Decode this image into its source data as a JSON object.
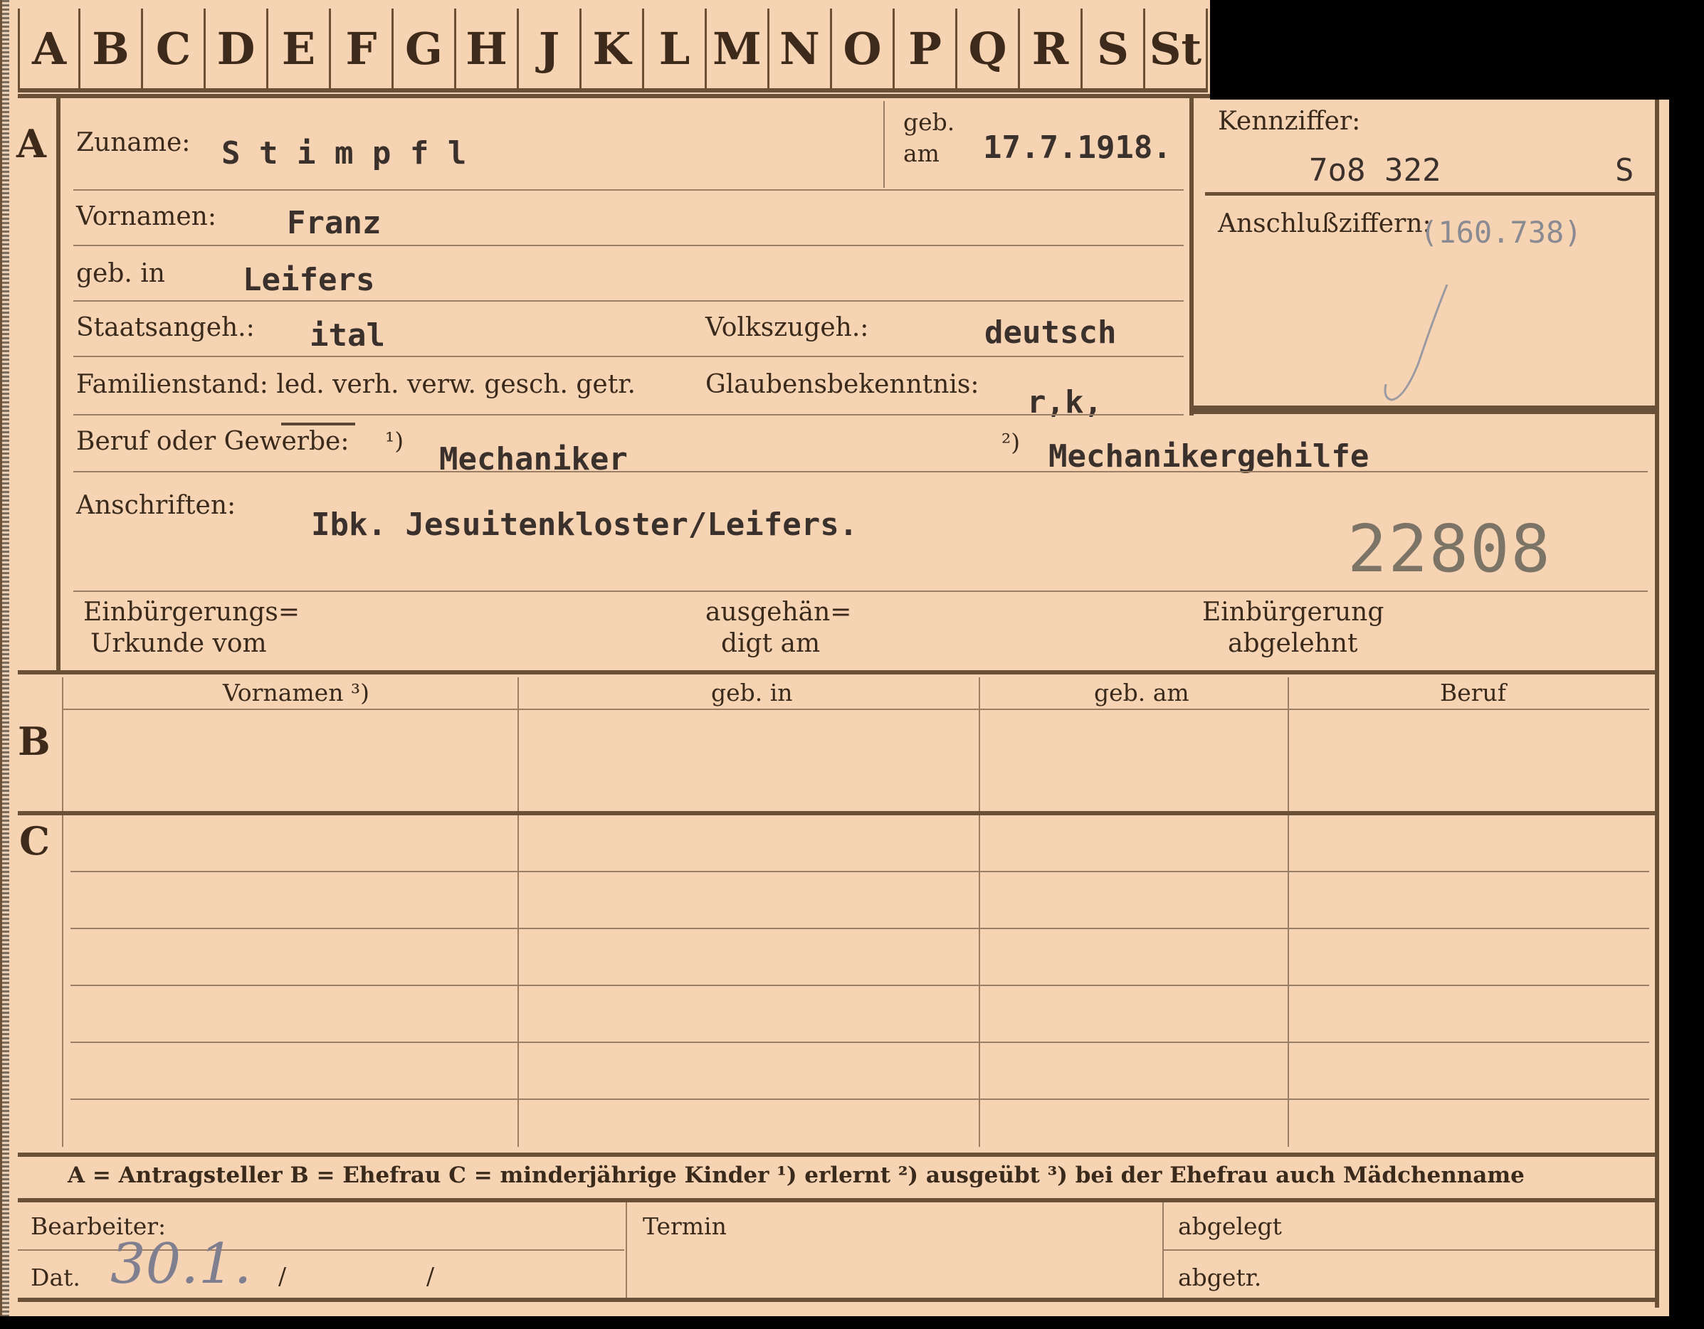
{
  "tabs": [
    "A",
    "B",
    "C",
    "D",
    "E",
    "F",
    "G",
    "H",
    "J",
    "K",
    "L",
    "M",
    "N",
    "O",
    "P",
    "Q",
    "R",
    "S",
    "St"
  ],
  "section_letters": {
    "a": "A",
    "b": "B",
    "c": "C"
  },
  "section_a": {
    "surname_label": "Zuname:",
    "surname_value": "S t i m p f l",
    "born_label_1": "geb.",
    "born_label_2": "am",
    "born_value": "17.7.1918.",
    "given_label": "Vornamen:",
    "given_value": "Franz",
    "birthplace_label": "geb. in",
    "birthplace_value": "Leifers",
    "citizenship_label": "Staatsangeh.:",
    "citizenship_value": "ital",
    "ethnicity_label": "Volkszugeh.:",
    "ethnicity_value": "deutsch",
    "marital_label": "Familienstand: led. verh. verw. gesch. getr.",
    "religion_label": "Glaubensbekenntnis:",
    "religion_value": "r,k,",
    "profession_label": "Beruf oder Gewerbe:",
    "profession_note1": "¹)",
    "profession_value1": "Mechaniker",
    "profession_note2": "²)",
    "profession_value2": "Mechanikergehilfe",
    "address_label": "Anschriften:",
    "address_value": "Ibk. Jesuitenkloster/Leifers.",
    "stamp_number": "22808",
    "naturalization_doc_1": "Einbürgerungs=",
    "naturalization_doc_2": "Urkunde vom",
    "handed_1": "ausgehän=",
    "handed_2": "digt am",
    "refused_1": "Einbürgerung",
    "refused_2": "abgelehnt"
  },
  "id_box": {
    "id_label": "Kennziffer:",
    "id_value": "7o8 322",
    "id_suffix": "S",
    "ref_label": "Anschlußziffern:",
    "ref_value": "(160.738)"
  },
  "section_b": {
    "headers": [
      "Vornamen ³)",
      "geb. in",
      "geb. am",
      "Beruf"
    ]
  },
  "legend": {
    "text": "A = Antragsteller   B = Ehefrau   C = minderjährige Kinder   ¹) erlernt   ²) ausgeübt   ³) bei der Ehefrau auch Mädchenname"
  },
  "footer": {
    "processor_label": "Bearbeiter:",
    "date_label": "Dat.",
    "date_handwritten": "30.1.",
    "date_slash_1": "/",
    "date_slash_2": "/",
    "deadline_label": "Termin",
    "filed_label": "abgelegt",
    "abgetr_label": "abgetr."
  },
  "colors": {
    "card": "#f6d3b2",
    "frame": "#6b5038",
    "typewriter": "#3a302c",
    "stamp": "#7d7468"
  }
}
